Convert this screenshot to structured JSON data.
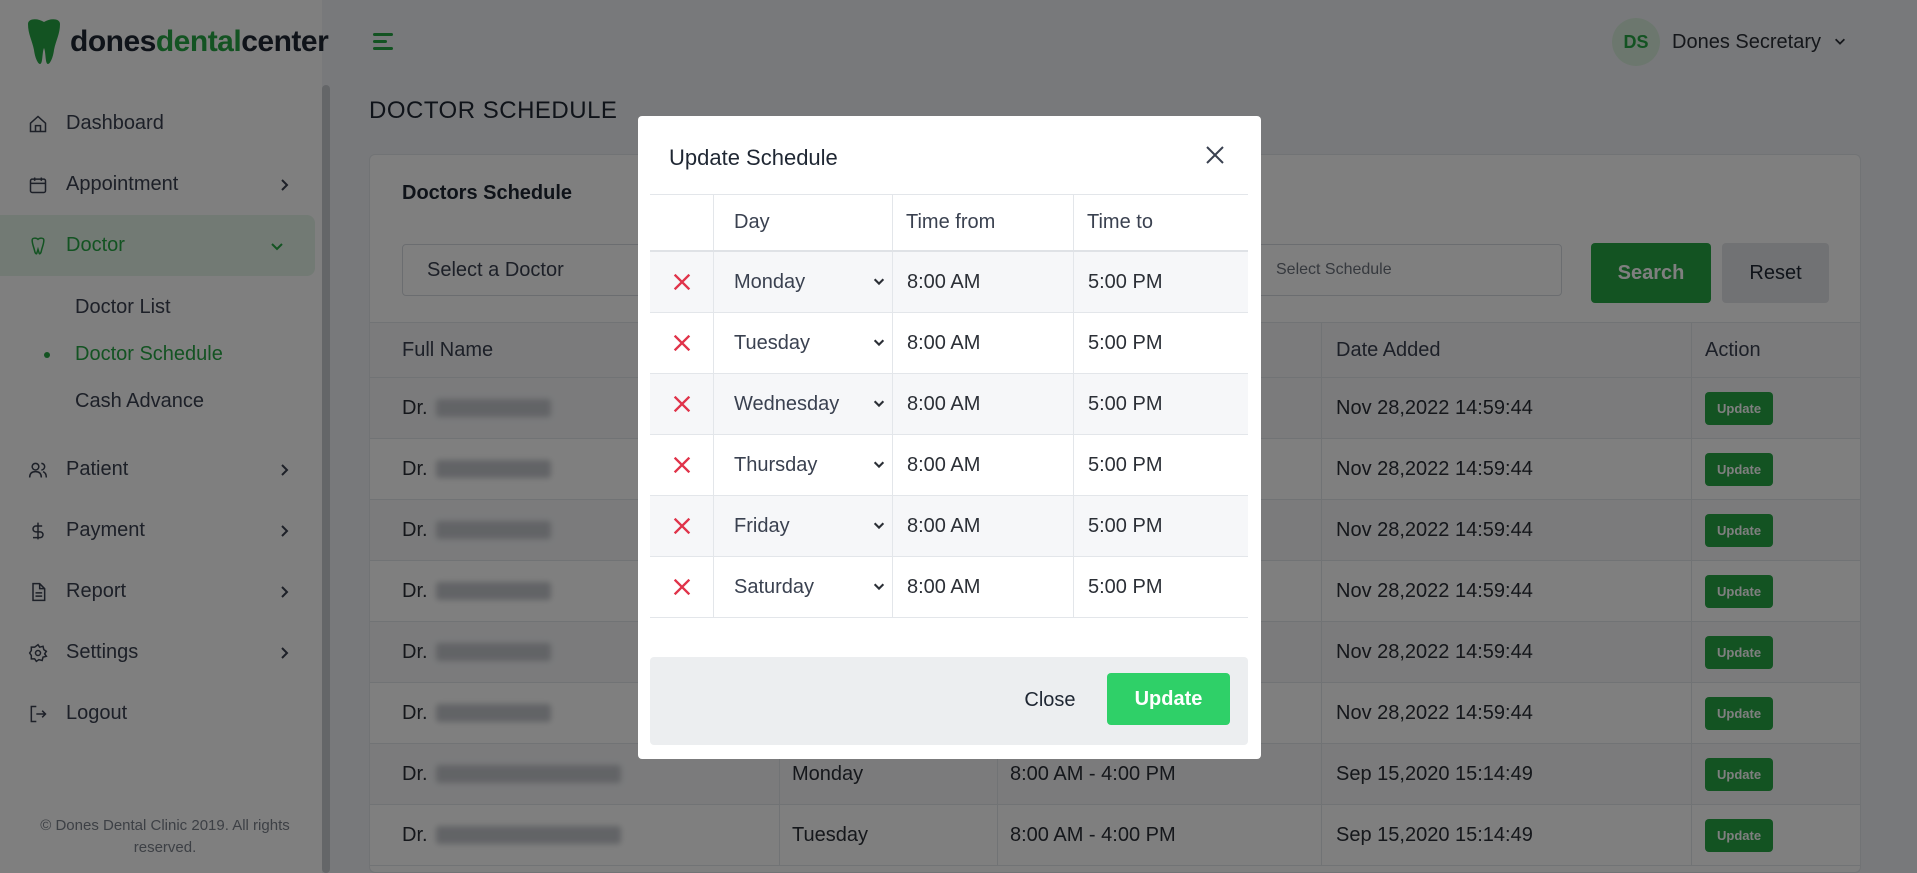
{
  "brand": {
    "part1": "dones",
    "part2": "dental",
    "part3": "center",
    "color": "#27a745"
  },
  "sidebar": {
    "items": [
      {
        "label": "Dashboard",
        "icon": "home-icon"
      },
      {
        "label": "Appointment",
        "icon": "calendar-icon"
      },
      {
        "label": "Doctor",
        "icon": "tooth-icon"
      },
      {
        "label": "Patient",
        "icon": "users-icon"
      },
      {
        "label": "Payment",
        "icon": "dollar-icon"
      },
      {
        "label": "Report",
        "icon": "document-icon"
      },
      {
        "label": "Settings",
        "icon": "gear-icon"
      },
      {
        "label": "Logout",
        "icon": "logout-icon"
      }
    ],
    "doctor_sub": [
      "Doctor List",
      "Doctor Schedule",
      "Cash Advance"
    ],
    "footer": "© Dones Dental Clinic 2019. All rights reserved."
  },
  "header": {
    "avatar": "DS",
    "user_name": "Dones Secretary"
  },
  "page": {
    "title": "DOCTOR SCHEDULE"
  },
  "card": {
    "title": "Doctors Schedule",
    "doctor_placeholder": "Select a Doctor",
    "schedule_placeholder": "Select Schedule",
    "search": "Search",
    "reset": "Reset"
  },
  "table": {
    "headers": [
      "Full Name",
      "",
      "",
      "Date Added",
      "Action"
    ],
    "prefix": "Dr.",
    "action_label": "Update",
    "rows": [
      {
        "day": "",
        "time": "",
        "date": "Nov 28,2022 14:59:44"
      },
      {
        "day": "",
        "time": "",
        "date": "Nov 28,2022 14:59:44"
      },
      {
        "day": "",
        "time": "",
        "date": "Nov 28,2022 14:59:44"
      },
      {
        "day": "",
        "time": "",
        "date": "Nov 28,2022 14:59:44"
      },
      {
        "day": "",
        "time": "",
        "date": "Nov 28,2022 14:59:44"
      },
      {
        "day": "",
        "time": "",
        "date": "Nov 28,2022 14:59:44"
      },
      {
        "day": "Monday",
        "time": "8:00 AM - 4:00 PM",
        "date": "Sep 15,2020 15:14:49"
      },
      {
        "day": "Tuesday",
        "time": "8:00 AM - 4:00 PM",
        "date": "Sep 15,2020 15:14:49"
      }
    ]
  },
  "modal": {
    "title": "Update Schedule",
    "headers": {
      "day": "Day",
      "from": "Time from",
      "to": "Time to"
    },
    "rows": [
      {
        "day": "Monday",
        "from": "8:00 AM",
        "to": "5:00 PM"
      },
      {
        "day": "Tuesday",
        "from": "8:00 AM",
        "to": "5:00 PM"
      },
      {
        "day": "Wednesday",
        "from": "8:00 AM",
        "to": "5:00 PM"
      },
      {
        "day": "Thursday",
        "from": "8:00 AM",
        "to": "5:00 PM"
      },
      {
        "day": "Friday",
        "from": "8:00 AM",
        "to": "5:00 PM"
      },
      {
        "day": "Saturday",
        "from": "8:00 AM",
        "to": "5:00 PM"
      }
    ],
    "close": "Close",
    "update": "Update"
  }
}
